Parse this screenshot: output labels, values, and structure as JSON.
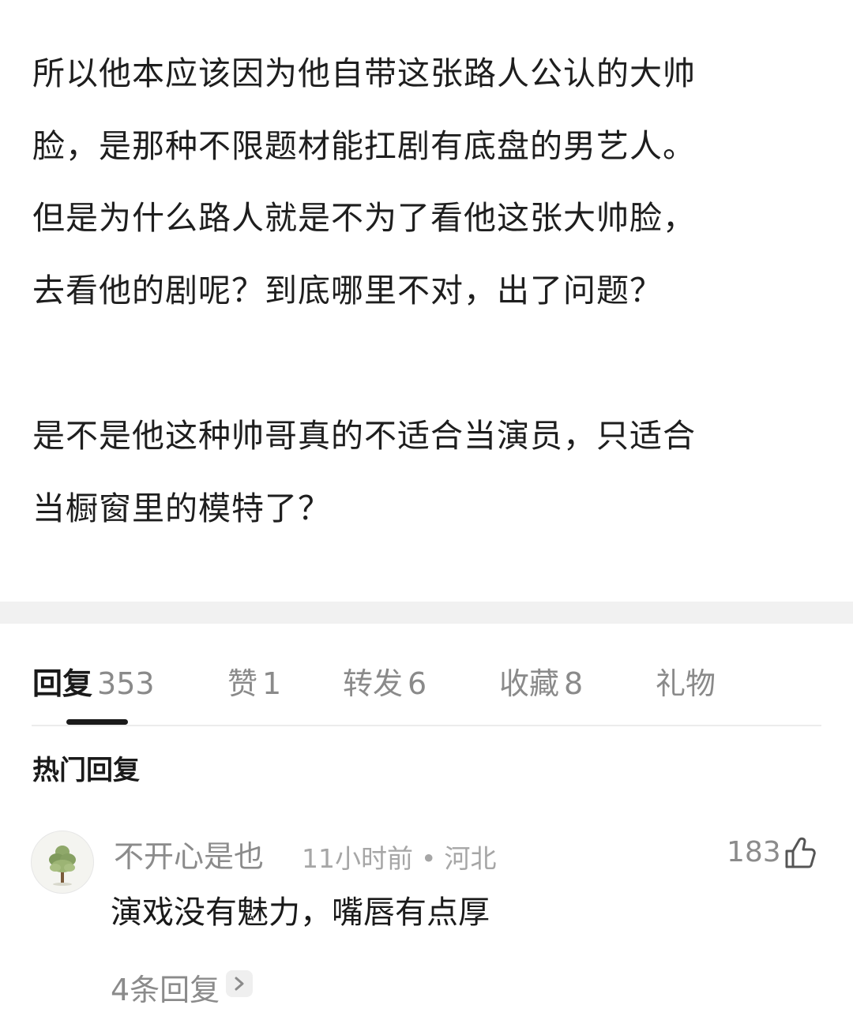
{
  "post": {
    "paragraph1": [
      "所以他本应该因为他自带这张路人公认的大帅",
      "脸，是那种不限题材能扛剧有底盘的男艺人。",
      "但是为什么路人就是不为了看他这张大帅脸，",
      "去看他的剧呢？到底哪里不对，出了问题？"
    ],
    "paragraph2": [
      "是不是他这种帅哥真的不适合当演员，只适合",
      "当橱窗里的模特了？"
    ]
  },
  "tabs": [
    {
      "label": "回复",
      "count": "353",
      "active": true
    },
    {
      "label": "赞",
      "count": "1",
      "active": false
    },
    {
      "label": "转发",
      "count": "6",
      "active": false
    },
    {
      "label": "收藏",
      "count": "8",
      "active": false
    },
    {
      "label": "礼物",
      "count": "",
      "active": false
    }
  ],
  "section_title": "热门回复",
  "comment": {
    "author": "不开心是也",
    "time": "11小时前",
    "separator": "•",
    "location": "河北",
    "like_count": "183",
    "text": "演戏没有魅力，嘴唇有点厚",
    "replies_label": "4条回复"
  },
  "colors": {
    "text_primary": "#1a1a1a",
    "text_secondary": "#8b8b8b",
    "divider_band": "#f1f1f1"
  },
  "icons": {
    "avatar": "tree-avatar",
    "like": "thumbs-up-icon",
    "chevron": "chevron-right-icon"
  }
}
